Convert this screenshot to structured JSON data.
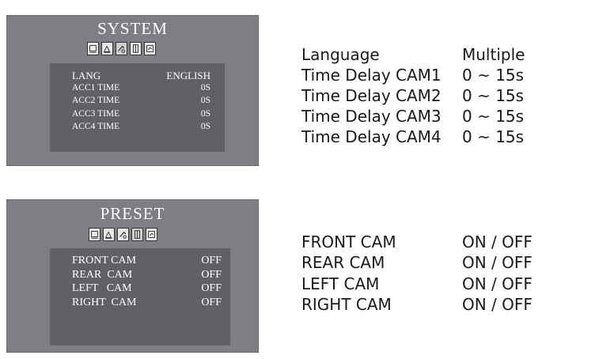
{
  "system_panel": {
    "title": "SYSTEM",
    "icons": [
      "display-setting-icon",
      "image-setting-icon",
      "system-setting-icon",
      "preset-setting-icon",
      "reset-icon"
    ],
    "rows": [
      {
        "label": "LANG",
        "value": "ENGLISH"
      },
      {
        "label": "ACC1 TIME",
        "value": "0S"
      },
      {
        "label": "ACC2 TIME",
        "value": "0S"
      },
      {
        "label": "ACC3 TIME",
        "value": "0S"
      },
      {
        "label": "ACC4 TIME",
        "value": "0S"
      }
    ]
  },
  "system_desc": [
    {
      "label": "Language",
      "value": "Multiple"
    },
    {
      "label": "Time Delay CAM1",
      "value": "0 ~ 15s"
    },
    {
      "label": "Time Delay CAM2",
      "value": "0 ~ 15s"
    },
    {
      "label": "Time Delay CAM3",
      "value": "0 ~ 15s"
    },
    {
      "label": "Time Delay CAM4",
      "value": "0 ~ 15s"
    }
  ],
  "preset_panel": {
    "title": "PRESET",
    "icons": [
      "display-setting-icon",
      "image-setting-icon",
      "system-setting-icon",
      "preset-setting-icon",
      "reset-icon"
    ],
    "rows": [
      {
        "label": "FRONT CAM",
        "value": "OFF"
      },
      {
        "label": "REAR  CAM",
        "value": "OFF"
      },
      {
        "label": "LEFT   CAM",
        "value": "OFF"
      },
      {
        "label": "RIGHT  CAM",
        "value": "OFF"
      }
    ]
  },
  "preset_desc": [
    {
      "label": "FRONT CAM",
      "value": "ON / OFF"
    },
    {
      "label": "REAR CAM",
      "value": "ON / OFF"
    },
    {
      "label": "LEFT CAM",
      "value": "ON / OFF"
    },
    {
      "label": "RIGHT CAM",
      "value": "ON / OFF"
    }
  ],
  "colors": {
    "osd_bg": "#7d7f84",
    "osd_inner": "#5f6166",
    "osd_text": "#ffffff"
  }
}
